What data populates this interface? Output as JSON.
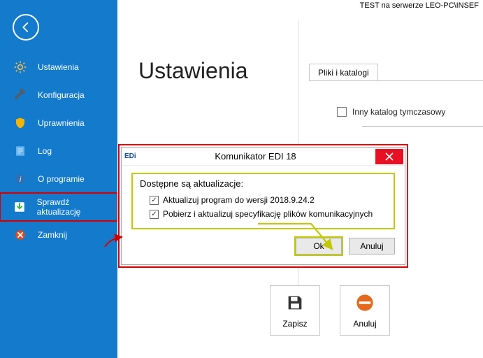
{
  "top_status": "TEST na serwerze LEO-PC\\INSEF",
  "sidebar": {
    "items": [
      {
        "label": "Ustawienia",
        "icon": "gear-icon"
      },
      {
        "label": "Konfiguracja",
        "icon": "wrench-icon"
      },
      {
        "label": "Uprawnienia",
        "icon": "shield-icon"
      },
      {
        "label": "Log",
        "icon": "document-icon"
      },
      {
        "label": "O programie",
        "icon": "info-icon"
      },
      {
        "label": "Sprawdź aktualizację",
        "icon": "download-icon"
      },
      {
        "label": "Zamknij",
        "icon": "close-circle-icon"
      }
    ]
  },
  "main": {
    "title": "Ustawienia",
    "tab": "Pliki i katalogi",
    "checkbox_label": "Inny katalog tymczasowy"
  },
  "dialog": {
    "app": "EDi",
    "title": "Komunikator EDI 18",
    "subtitle": "Dostępne są aktualizacje:",
    "opt1": "Aktualizuj program do wersji 2018.9.24.2",
    "opt2": "Pobierz i aktualizuj specyfikację plików komunikacyjnych",
    "ok": "Ok",
    "cancel": "Anuluj"
  },
  "bottom": {
    "save": "Zapisz",
    "cancel": "Anuluj"
  }
}
